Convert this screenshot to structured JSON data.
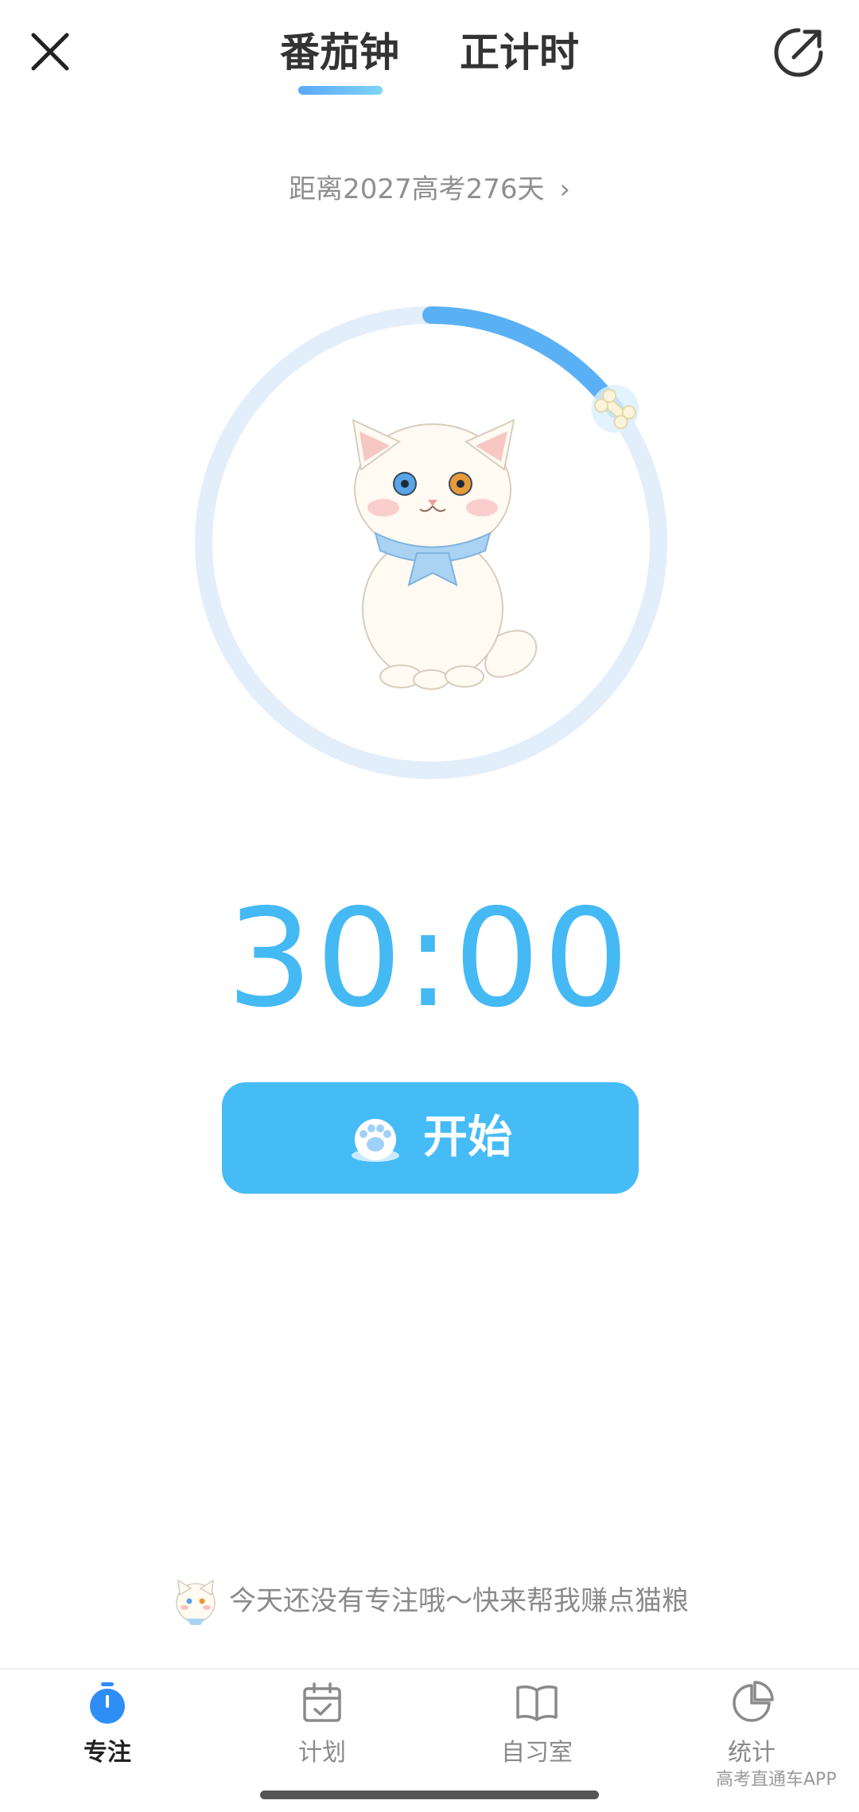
{
  "header": {
    "tabs": [
      {
        "label": "番茄钟",
        "active": true
      },
      {
        "label": "正计时",
        "active": false
      }
    ],
    "close_icon": "close-icon",
    "share_icon": "share-out-icon"
  },
  "countdown": {
    "text": "距离2027高考276天",
    "chevron": "›"
  },
  "ring": {
    "progress_fraction": 0.15,
    "track_color": "#e3eefb",
    "progress_color": "#5ab0f5"
  },
  "timer": {
    "value": "30:00"
  },
  "start_button": {
    "label": "开始",
    "icon": "paw-icon"
  },
  "tip": {
    "text": "今天还没有专注哦～快来帮我赚点猫粮"
  },
  "bottom_nav": [
    {
      "label": "专注",
      "icon": "stopwatch-icon",
      "active": true
    },
    {
      "label": "计划",
      "icon": "calendar-check-icon",
      "active": false
    },
    {
      "label": "自习室",
      "icon": "book-icon",
      "active": false
    },
    {
      "label": "统计",
      "icon": "pie-chart-icon",
      "active": false
    }
  ],
  "watermark": "高考直通车APP",
  "colors": {
    "accent": "#46bcf6",
    "timer": "#45b9f4",
    "active_nav": "#2f8ef5"
  }
}
